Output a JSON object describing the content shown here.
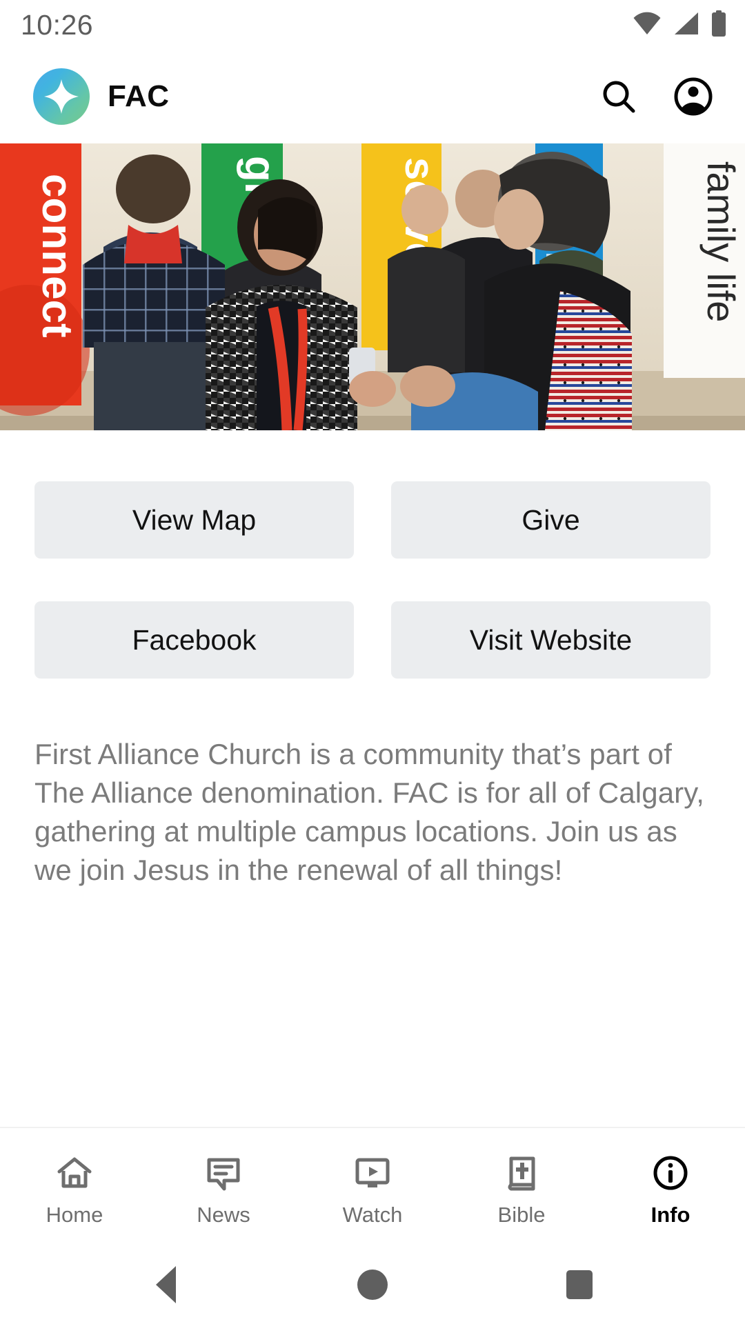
{
  "status_bar": {
    "time": "10:26",
    "icons": [
      "wifi-icon",
      "cellular-signal-icon",
      "battery-icon"
    ]
  },
  "app_bar": {
    "logo_icon": "fac-sparkle-logo-icon",
    "title": "FAC",
    "actions": [
      {
        "name": "search-icon",
        "label": "Search"
      },
      {
        "name": "account-circle-icon",
        "label": "Account"
      }
    ]
  },
  "hero": {
    "alt": "Church lobby with people talking near ministry banners",
    "banners": [
      "connect",
      "grow",
      "serve",
      "family life"
    ]
  },
  "actions": {
    "row1": [
      {
        "label": "View Map",
        "name": "view-map-button"
      },
      {
        "label": "Give",
        "name": "give-button"
      }
    ],
    "row2": [
      {
        "label": "Facebook",
        "name": "facebook-button"
      },
      {
        "label": "Visit Website",
        "name": "visit-website-button"
      }
    ]
  },
  "description": "First Alliance Church is a community that’s part of The Alliance denomination. FAC is for all of Calgary, gathering at multiple campus locations. Join us as we join Jesus in the renewal of all things!",
  "tab_bar": {
    "active": "Info",
    "items": [
      {
        "label": "Home",
        "icon": "home-icon"
      },
      {
        "label": "News",
        "icon": "chat-bubble-icon"
      },
      {
        "label": "Watch",
        "icon": "video-monitor-icon"
      },
      {
        "label": "Bible",
        "icon": "bible-book-icon"
      },
      {
        "label": "Info",
        "icon": "info-circle-icon"
      }
    ]
  },
  "nav_bar": {
    "back": "back-button",
    "home": "home-button",
    "recents": "recents-button"
  },
  "colors": {
    "button_bg": "#ebedef",
    "text_primary": "#121212",
    "text_muted": "#7b7b7b",
    "tab_inactive": "#6e6e6e",
    "tab_active": "#000000",
    "logo_gradient_start": "#4aa8e8",
    "logo_gradient_end": "#78c98a"
  }
}
